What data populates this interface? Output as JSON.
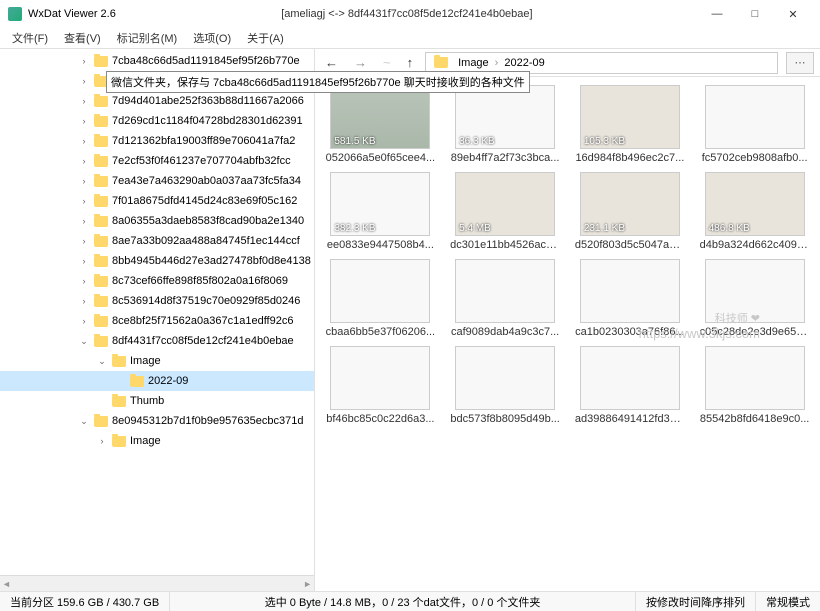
{
  "window": {
    "title": "WxDat Viewer 2.6",
    "center": "[ameliagj <-> 8df4431f7cc08f5de12cf241e4b0ebae]",
    "min": "—",
    "max": "□",
    "close": "✕"
  },
  "menu": {
    "file": "文件(F)",
    "view": "查看(V)",
    "tag": "标记别名(M)",
    "options": "选项(O)",
    "about": "关于(A)"
  },
  "tooltip": "微信文件夹，保存与 7cba48c66d5ad1191845ef95f26b770e 聊天时接收到的各种文件",
  "tree": [
    {
      "indent": 1,
      "chev": ">",
      "label": "7cba48c66d5ad1191845ef95f26b770e"
    },
    {
      "indent": 1,
      "chev": ">",
      "label": "7cba48c66d5ad1191845ef95f26b770e"
    },
    {
      "indent": 1,
      "chev": ">",
      "label": "7d94d401abe252f363b88d11667a2066"
    },
    {
      "indent": 1,
      "chev": ">",
      "label": "7d269cd1c1184f04728bd28301d62391"
    },
    {
      "indent": 1,
      "chev": ">",
      "label": "7d121362bfa19003ff89e706041a7fa2"
    },
    {
      "indent": 1,
      "chev": ">",
      "label": "7e2cf53f0f461237e707704abfb32fcc"
    },
    {
      "indent": 1,
      "chev": ">",
      "label": "7ea43e7a463290ab0a037aa73fc5fa34"
    },
    {
      "indent": 1,
      "chev": ">",
      "label": "7f01a8675dfd4145d24c83e69f05c162"
    },
    {
      "indent": 1,
      "chev": ">",
      "label": "8a06355a3daeb8583f8cad90ba2e1340"
    },
    {
      "indent": 1,
      "chev": ">",
      "label": "8ae7a33b092aa488a84745f1ec144ccf"
    },
    {
      "indent": 1,
      "chev": ">",
      "label": "8bb4945b446d27e3ad27478bf0d8e4138"
    },
    {
      "indent": 1,
      "chev": ">",
      "label": "8c73cef66ffe898f85f802a0a16f8069"
    },
    {
      "indent": 1,
      "chev": ">",
      "label": "8c536914d8f37519c70e0929f85d0246"
    },
    {
      "indent": 1,
      "chev": ">",
      "label": "8ce8bf25f71562a0a367c1a1edff92c6"
    },
    {
      "indent": 1,
      "chev": "v",
      "label": "8df4431f7cc08f5de12cf241e4b0ebae"
    },
    {
      "indent": 2,
      "chev": "v",
      "label": "Image"
    },
    {
      "indent": 3,
      "chev": "",
      "label": "2022-09",
      "sel": true
    },
    {
      "indent": 2,
      "chev": "",
      "label": "Thumb"
    },
    {
      "indent": 1,
      "chev": "v",
      "label": "8e0945312b7d1f0b9e957635ecbc371d"
    },
    {
      "indent": 2,
      "chev": ">",
      "label": "Image"
    }
  ],
  "nav": {
    "back": "←",
    "fwd": "→",
    "up": "↑",
    "crumb1": "Image",
    "crumb2": "2022-09",
    "sep": "›",
    "more": "⋯"
  },
  "thumbs": [
    {
      "size": "581.5 KB",
      "name": "052066a5e0f65cee4...",
      "cls": "photo1"
    },
    {
      "size": "36.3 KB",
      "name": "89eb4ff7a2f73c3bca...",
      "cls": "doc"
    },
    {
      "size": "105.3 KB",
      "name": "16d984f8b496ec2c7...",
      "cls": "photo2"
    },
    {
      "size": "",
      "name": "fc5702ceb9808afb0...",
      "cls": "doc"
    },
    {
      "size": "382.3 KB",
      "name": "ee0833e9447508b4...",
      "cls": "doc"
    },
    {
      "size": "5.4 MB",
      "name": "dc301e11bb4526ac5...",
      "cls": "photo2"
    },
    {
      "size": "231.1 KB",
      "name": "d520f803d5c5047ada...",
      "cls": "photo2"
    },
    {
      "size": "486.8 KB",
      "name": "d4b9a324d662c4093...",
      "cls": "photo2"
    },
    {
      "size": "",
      "name": "cbaa6bb5e37f06206...",
      "cls": "doc"
    },
    {
      "size": "",
      "name": "caf9089dab4a9c3c7...",
      "cls": "doc"
    },
    {
      "size": "",
      "name": "ca1b0230303a76f86...",
      "cls": "doc"
    },
    {
      "size": "",
      "name": "c05c28de2e3d9e65c...",
      "cls": "doc"
    },
    {
      "size": "",
      "name": "bf46bc85c0c22d6a3...",
      "cls": "doc"
    },
    {
      "size": "",
      "name": "bdc573f8b8095d49b...",
      "cls": "doc"
    },
    {
      "size": "",
      "name": "ad39886491412fd39...",
      "cls": "doc"
    },
    {
      "size": "",
      "name": "85542b8fd6418e9c0...",
      "cls": "doc"
    }
  ],
  "watermark": {
    "title": "科技师 ❤",
    "url": "https://www.3kjs.com"
  },
  "status": {
    "disk": "当前分区 159.6 GB / 430.7 GB",
    "sel": "选中 0 Byte / 14.8 MB，0 / 23 个dat文件，0 / 0 个文件夹",
    "sort": "按修改时间降序排列",
    "mode": "常规模式"
  }
}
